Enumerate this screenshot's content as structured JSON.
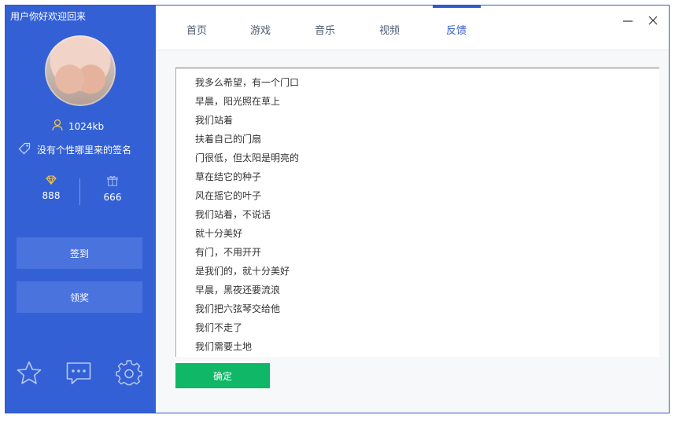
{
  "sidebar": {
    "greeting": "用户你好欢迎回来",
    "size": "1024kb",
    "signature": "没有个性哪里来的签名",
    "stats": [
      {
        "icon": "diamond-icon",
        "value": "888"
      },
      {
        "icon": "gift-icon",
        "value": "666"
      }
    ],
    "buttons": {
      "signin": "签到",
      "claim": "领奖"
    },
    "bottom_icons": [
      "star-icon",
      "chat-icon",
      "gear-icon"
    ]
  },
  "tabs": [
    {
      "label": "首页"
    },
    {
      "label": "游戏"
    },
    {
      "label": "音乐"
    },
    {
      "label": "视频"
    },
    {
      "label": "反馈",
      "active": true
    }
  ],
  "window_controls": {
    "minimize": "—",
    "close": "✕"
  },
  "feedback": {
    "lines": [
      "我多么希望，有一个门口",
      "早晨，阳光照在草上",
      "我们站着",
      "扶着自己的门扇",
      "门很低，但太阳是明亮的",
      "草在结它的种子",
      "风在摇它的叶子",
      "我们站着，不说话",
      "就十分美好",
      "有门，不用开开",
      "是我们的，就十分美好",
      "早晨，黑夜还要流浪",
      "我们把六弦琴交给他",
      "我们不走了",
      "我们需要土地"
    ],
    "confirm_label": "确定"
  },
  "colors": {
    "sidebar": "#3460d6",
    "accent": "#3157d1",
    "confirm": "#10b767"
  }
}
